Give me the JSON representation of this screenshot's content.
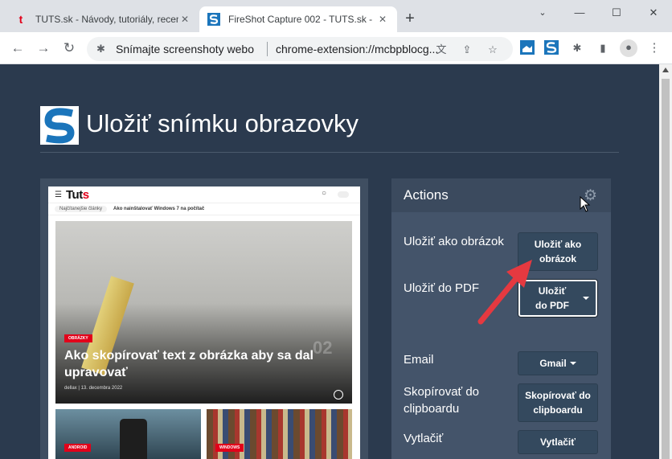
{
  "browser": {
    "tabs": [
      {
        "title": "TUTS.sk - Návody, tutoriály, recen",
        "active": false
      },
      {
        "title": "FireShot Capture 002 - TUTS.sk -",
        "active": true
      }
    ],
    "omnibox_label": "Snímajte screenshoty webo",
    "url": "chrome-extension://mcbpblocg..."
  },
  "page": {
    "title": "Uložiť snímku obrazovky"
  },
  "preview": {
    "site_logo_text": "Tut",
    "site_logo_accent": "s",
    "tag_popular": "Najčítanejšie články",
    "bar_title": "Ako nainštalovať Windows 7 na počítač",
    "hero_category": "OBRÁZKY",
    "hero_title": "Ako skopírovať text z obrázka aby sa dal upravovať",
    "hero_number": "02",
    "hero_meta": "dellax  |  13. decembra 2022",
    "card1_tag": "ANDROID",
    "card2_tag": "WINDOWS"
  },
  "actions": {
    "title": "Actions",
    "rows": [
      {
        "label": "Uložiť ako obrázok",
        "button": "Uložiť ako obrázok"
      },
      {
        "label": "Uložiť do PDF",
        "button": "Uložiť do PDF"
      },
      {
        "label": "Email",
        "button": "Gmail"
      },
      {
        "label": "Skopírovať do clipboardu",
        "button": "Skopírovať do clipboardu"
      },
      {
        "label": "Vytlačiť",
        "button": "Vytlačiť"
      }
    ]
  },
  "colors": {
    "page_bg": "#2b3a4e",
    "panel_bg": "#44546a",
    "button_bg": "#34495e",
    "accent_red": "#e2001a",
    "arrow": "#e53940"
  }
}
